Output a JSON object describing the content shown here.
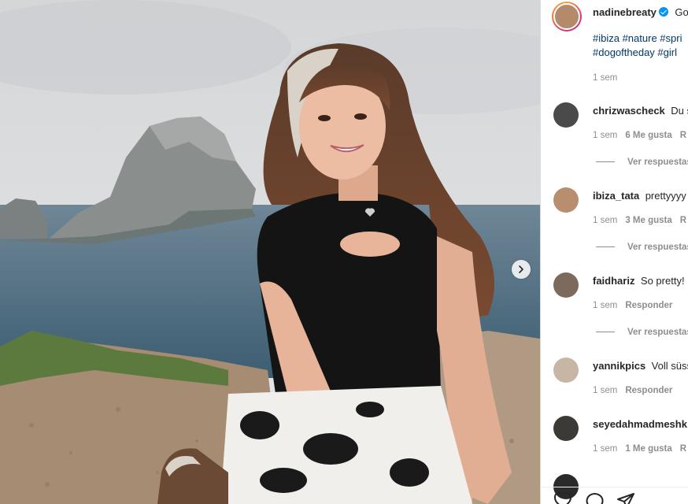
{
  "post": {
    "author": "nadinebreaty",
    "caption_start": "Go",
    "hashtags_line1": "#ibiza #nature #spri",
    "hashtags_line2": "#dogoftheday #girl",
    "time": "1 sem"
  },
  "comments": [
    {
      "user": "chrizwascheck",
      "text": "Du s",
      "time": "1 sem",
      "likes": "6 Me gusta",
      "reply": "R",
      "view_replies": "Ver respuestas"
    },
    {
      "user": "ibiza_tata",
      "text": "prettyyyy",
      "time": "1 sem",
      "likes": "3 Me gusta",
      "reply": "R",
      "view_replies": "Ver respuestas"
    },
    {
      "user": "faidhariz",
      "text": "So pretty!",
      "time": "1 sem",
      "reply": "Responder",
      "view_replies": "Ver respuestas"
    },
    {
      "user": "yannikpics",
      "text": "Voll süss",
      "time": "1 sem",
      "reply": "Responder"
    },
    {
      "user": "seyedahmadmeshk",
      "text": "",
      "time": "1 sem",
      "likes": "1 Me gusta",
      "reply": "R"
    }
  ],
  "icons": [
    "heart-icon",
    "comment-icon",
    "share-icon",
    "chevron-right-icon"
  ],
  "colors": {
    "link": "#00376b",
    "verified": "#0095f6",
    "muted": "#8e8e8e",
    "text": "#262626"
  }
}
